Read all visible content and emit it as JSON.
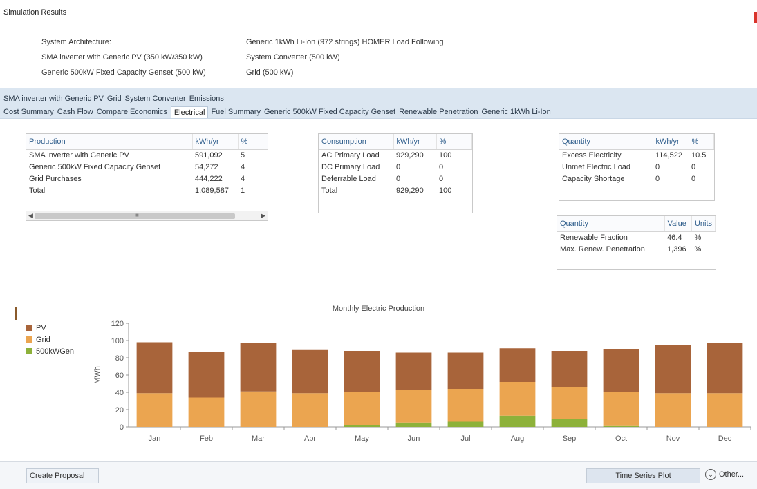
{
  "window": {
    "title": "Simulation Results"
  },
  "architecture": {
    "rows": [
      {
        "left": "System Architecture:",
        "right": "Generic 1kWh Li-Ion (972 strings) HOMER Load Following"
      },
      {
        "left": "SMA inverter with Generic PV (350 kW/350 kW)",
        "right": "System Converter (500 kW)"
      },
      {
        "left": "Generic 500kW Fixed Capacity Genset (500 kW)",
        "right": "Grid (500 kW)"
      }
    ]
  },
  "tabs": {
    "row1": [
      "SMA inverter with Generic PV",
      "Grid",
      "System Converter",
      "Emissions"
    ],
    "row2": [
      "Cost Summary",
      "Cash Flow",
      "Compare Economics",
      "Electrical",
      "Fuel Summary",
      "Generic 500kW Fixed Capacity Genset",
      "Renewable Penetration",
      "Generic 1kWh Li-Ion"
    ],
    "active": "Electrical"
  },
  "production": {
    "headers": [
      "Production",
      "kWh/yr",
      "%"
    ],
    "rows": [
      [
        "SMA inverter with Generic PV",
        "591,092",
        "5"
      ],
      [
        "Generic 500kW Fixed Capacity Genset",
        "54,272",
        "4"
      ],
      [
        "Grid Purchases",
        "444,222",
        "4"
      ],
      [
        "Total",
        "1,089,587",
        "1"
      ]
    ]
  },
  "consumption": {
    "headers": [
      "Consumption",
      "kWh/yr",
      "%"
    ],
    "rows": [
      [
        "AC Primary Load",
        "929,290",
        "100"
      ],
      [
        "DC Primary Load",
        "0",
        "0"
      ],
      [
        "Deferrable Load",
        "0",
        "0"
      ],
      [
        "Total",
        "929,290",
        "100"
      ]
    ]
  },
  "quantity1": {
    "headers": [
      "Quantity",
      "kWh/yr",
      "%"
    ],
    "rows": [
      [
        "Excess Electricity",
        "114,522",
        "10.5"
      ],
      [
        "Unmet Electric Load",
        "0",
        "0"
      ],
      [
        "Capacity Shortage",
        "0",
        "0"
      ]
    ]
  },
  "quantity2": {
    "headers": [
      "Quantity",
      "Value",
      "Units"
    ],
    "rows": [
      [
        "Renewable Fraction",
        "46.4",
        "%"
      ],
      [
        "Max. Renew. Penetration",
        "1,396",
        "%"
      ]
    ]
  },
  "chart_data": {
    "type": "bar",
    "stacked": true,
    "title": "Monthly Electric Production",
    "xlabel": "",
    "ylabel": "MWh",
    "ylim": [
      0,
      120
    ],
    "yticks": [
      0,
      20,
      40,
      60,
      80,
      100,
      120
    ],
    "categories": [
      "Jan",
      "Feb",
      "Mar",
      "Apr",
      "May",
      "Jun",
      "Jul",
      "Aug",
      "Sep",
      "Oct",
      "Nov",
      "Dec"
    ],
    "series": [
      {
        "name": "500kWGen",
        "color": "#8db13a",
        "values": [
          0,
          0,
          0,
          0,
          2,
          5,
          6,
          13,
          9,
          1,
          0,
          0
        ]
      },
      {
        "name": "Grid",
        "color": "#eba550",
        "values": [
          39,
          34,
          41,
          39,
          38,
          38,
          38,
          39,
          37,
          39,
          39,
          39
        ]
      },
      {
        "name": "PV",
        "color": "#a8643a",
        "values": [
          59,
          53,
          56,
          50,
          48,
          43,
          42,
          39,
          42,
          50,
          56,
          58
        ]
      }
    ],
    "legend_order": [
      "PV",
      "Grid",
      "500kWGen"
    ],
    "grid": false,
    "legend_position": "left"
  },
  "buttons": {
    "create_proposal": "Create Proposal",
    "time_series_plot": "Time Series Plot",
    "other": "Other..."
  },
  "colors": {
    "pv": "#a8643a",
    "grid": "#eba550",
    "gen": "#8db13a",
    "tab_band": "#dbe6f1",
    "header_text": "#2f5e8c"
  }
}
